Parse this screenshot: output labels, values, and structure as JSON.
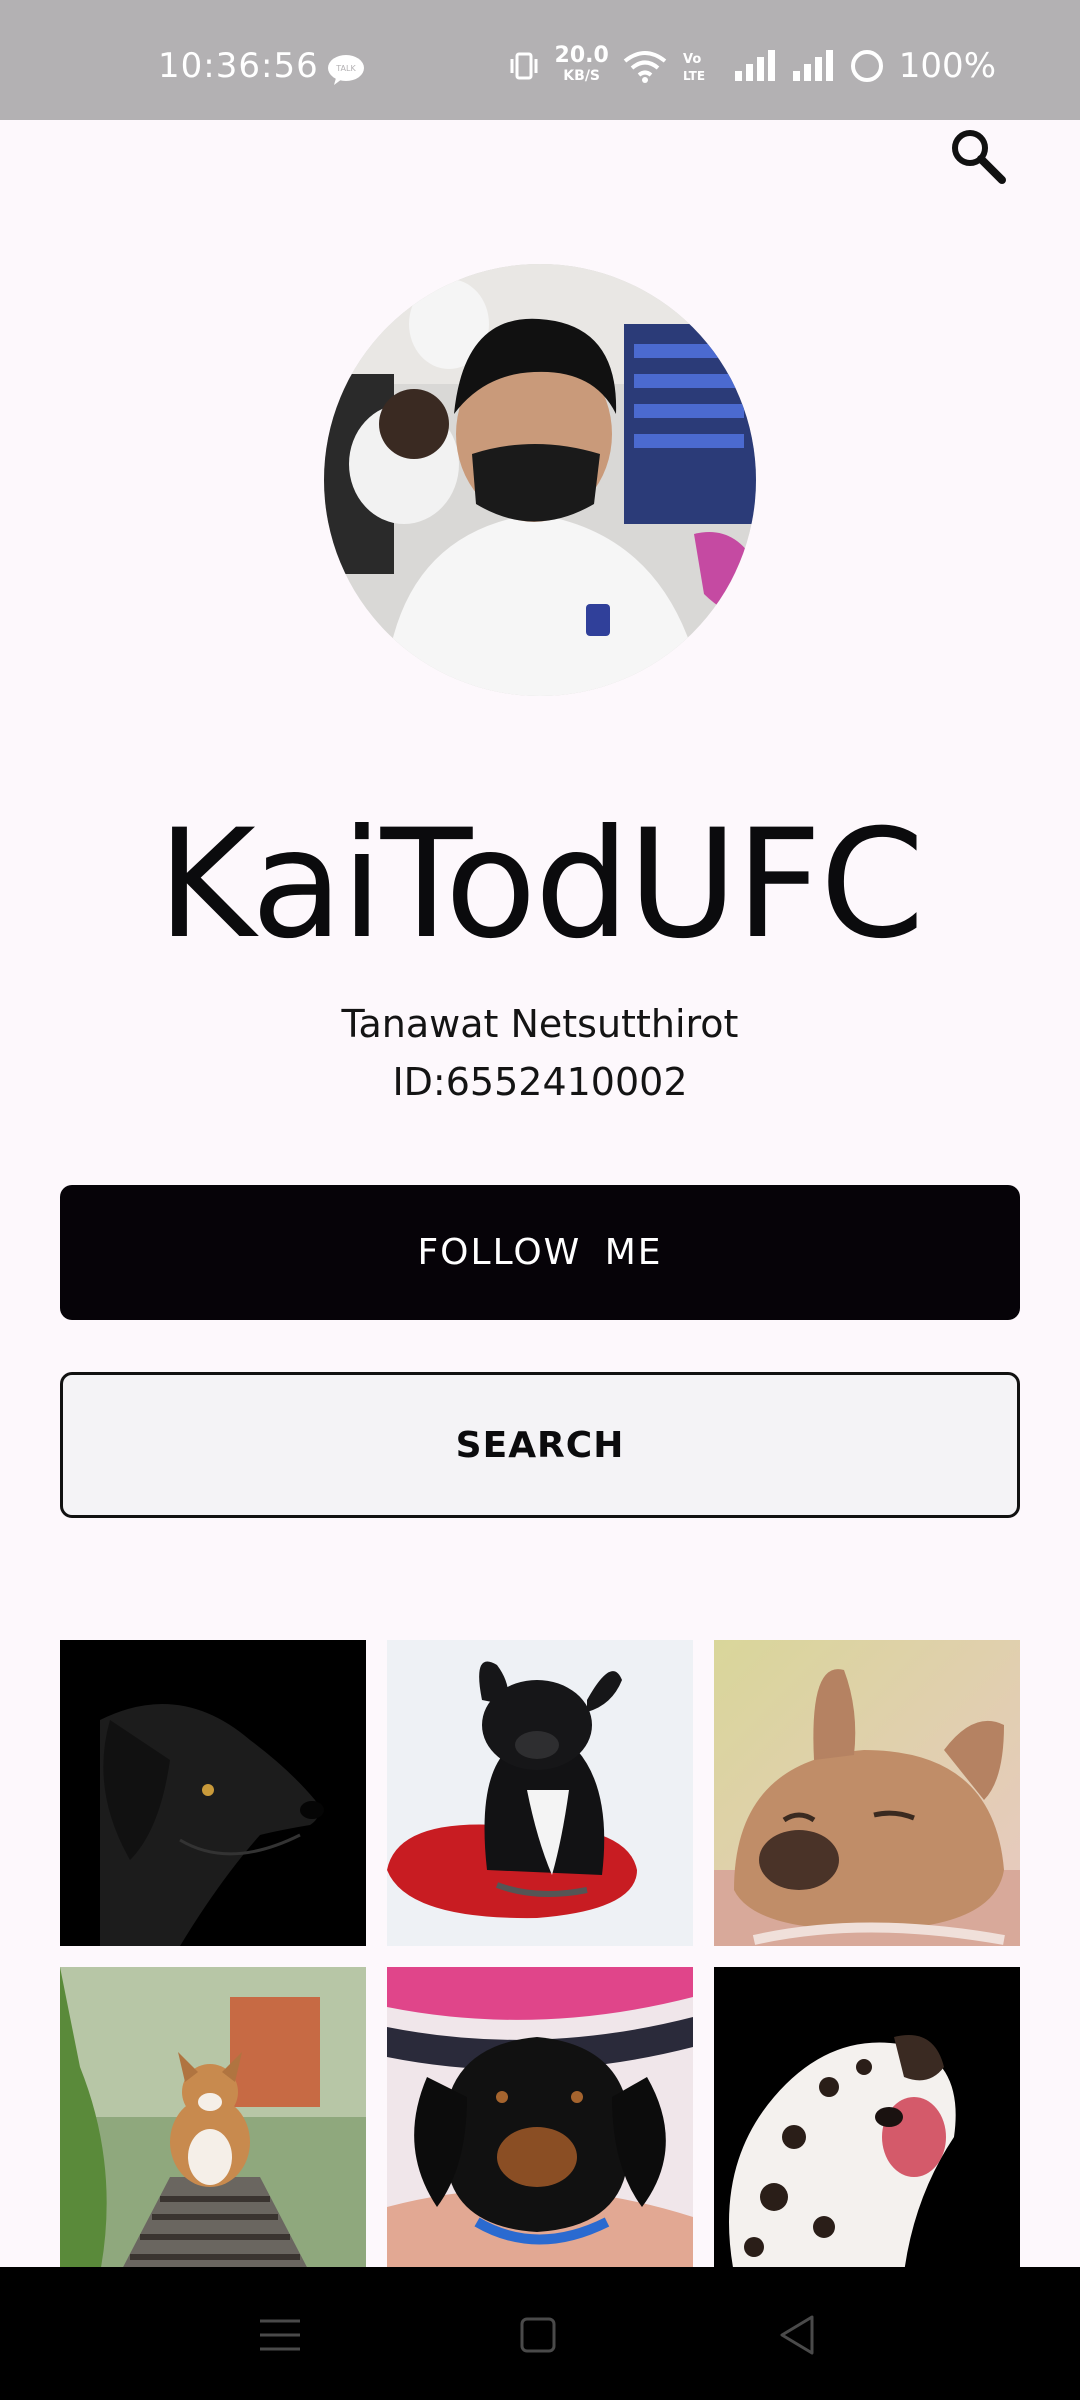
{
  "status_bar": {
    "time": "10:36:56",
    "speed_value": "20.0",
    "speed_unit": "KB/S",
    "volte_label": "Vo LTE",
    "battery": "100%",
    "icons": [
      "talk-icon",
      "vibrate-icon",
      "wifi-icon",
      "volte-icon",
      "signal-icon",
      "signal-icon",
      "battery-icon"
    ]
  },
  "profile": {
    "username": "KaiTodUFC",
    "full_name": "Tanawat Netsutthirot",
    "id_text": "ID:6552410002"
  },
  "buttons": {
    "follow_label": "FOLLOW  ME",
    "search_label": "SEARCH"
  },
  "gallery": [
    {
      "subject": "black dog profile"
    },
    {
      "subject": "french bulldog on red cushion"
    },
    {
      "subject": "fawn french bulldog lying"
    },
    {
      "subject": "corgi on railway"
    },
    {
      "subject": "dachshund puppy"
    },
    {
      "subject": "dalmatian licking"
    }
  ],
  "nav": {
    "icons": [
      "menu-icon",
      "home-icon",
      "back-icon"
    ]
  },
  "colors": {
    "background": "#fdf8fc",
    "primary_button": "#060308",
    "status_bar": "#b3b1b3"
  }
}
